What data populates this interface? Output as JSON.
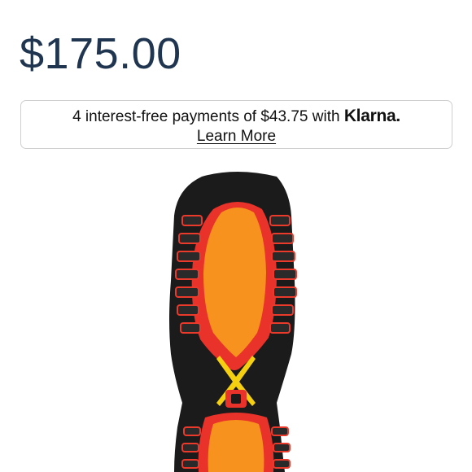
{
  "product": {
    "price": "$175.00",
    "image_alt": "Boot outsole"
  },
  "klarna": {
    "message": "4 interest-free payments of $43.75 with ",
    "brand": "Klarna.",
    "learn_more": "Learn More"
  },
  "colors": {
    "price_text": "#1f3550",
    "sole_black": "#1b1b1b",
    "sole_red": "#e8322a",
    "sole_orange": "#f7921e",
    "sole_yellow": "#f5d010"
  }
}
